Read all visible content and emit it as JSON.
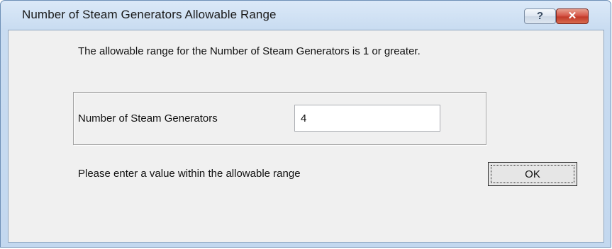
{
  "window": {
    "title": "Number of Steam Generators Allowable Range",
    "help_glyph": "?",
    "close_glyph": "✕"
  },
  "dialog": {
    "message": "The allowable range for the Number of Steam Generators is 1 or greater.",
    "field_label": "Number of Steam Generators",
    "field_value": "4",
    "hint": "Please enter a value within the allowable range",
    "ok_label": "OK"
  },
  "colors": {
    "close_button": "#c7412f",
    "title_bar": "#c9dcf1",
    "client": "#f0f0f0"
  },
  "icons": [
    "help-icon",
    "close-icon"
  ]
}
